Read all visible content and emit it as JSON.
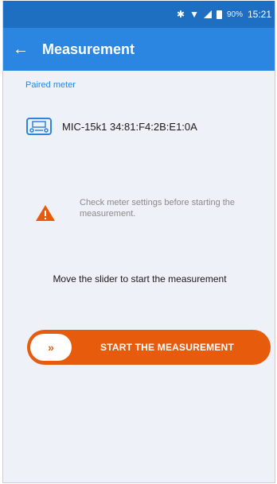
{
  "status_bar": {
    "icons": [
      "bluetooth-icon",
      "wifi-icon",
      "signal-icon",
      "battery-icon"
    ],
    "battery": "90%",
    "time": "15:21"
  },
  "app_bar": {
    "back_icon": "arrow-left-icon",
    "title": "Measurement"
  },
  "paired_meter": {
    "label": "Paired meter",
    "icon": "meter-device-icon",
    "name": "MIC-15k1 34:81:F4:2B:E1:0A"
  },
  "warning": {
    "icon": "warning-triangle-icon",
    "text": "Check meter settings before starting the measurement."
  },
  "slider": {
    "hint": "Move the slider to start the measurement",
    "knob_glyph": "»",
    "label": "START THE MEASUREMENT",
    "color": "#e65c0c"
  },
  "colors": {
    "status_bar": "#1e6fc2",
    "app_bar": "#2a86e0",
    "accent": "#2a86e0",
    "warning": "#e65c0c",
    "background": "#eef1f7"
  }
}
